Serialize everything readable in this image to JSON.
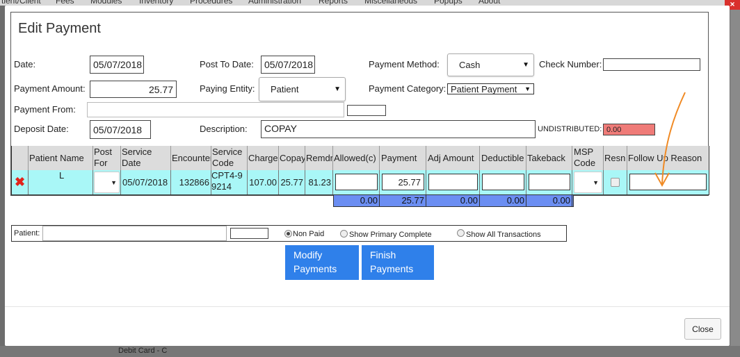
{
  "background": {
    "menu": [
      "tient/Client",
      "Fees",
      "Modules",
      "Inventory",
      "Procedures",
      "Administration",
      "Reports",
      "Miscellaneous",
      "Popups",
      "About"
    ],
    "close_icon": "×",
    "bottom_fragment": "Debit Card - C"
  },
  "modal": {
    "title": "Edit Payment",
    "close_label": "Close"
  },
  "form": {
    "date": {
      "label": "Date:",
      "value": "05/07/2018"
    },
    "post_to_date": {
      "label": "Post To Date:",
      "value": "05/07/2018"
    },
    "payment_method": {
      "label": "Payment Method:",
      "value": "Cash"
    },
    "check_number": {
      "label": "Check Number:",
      "value": ""
    },
    "payment_amount": {
      "label": "Payment Amount:",
      "value": "25.77"
    },
    "paying_entity": {
      "label": "Paying Entity:",
      "value": "Patient"
    },
    "payment_category": {
      "label": "Payment Category:",
      "value": "Patient Payment"
    },
    "payment_from": {
      "label": "Payment From:",
      "value": ""
    },
    "deposit_date": {
      "label": "Deposit Date:",
      "value": "05/07/2018"
    },
    "description": {
      "label": "Description:",
      "value": "COPAY"
    },
    "undistributed": {
      "label": "UNDISTRIBUTED:",
      "value": "0.00",
      "color": "#ef7b78"
    }
  },
  "grid": {
    "headers": {
      "patient_name": "Patient Name",
      "post_for": "Post For",
      "service_date": "Service Date",
      "encounter": "Encounter",
      "service_code": "Service Code",
      "charge": "Charge",
      "copay": "Copay",
      "remdr": "Remdr",
      "allowed": "Allowed(c)",
      "payment": "Payment",
      "adj_amount": "Adj Amount",
      "deductible": "Deductible",
      "takeback": "Takeback",
      "msp_code": "MSP Code",
      "resn": "Resn",
      "follow_up_reason": "Follow Up Reason"
    },
    "row": {
      "delete_icon": "✖",
      "patient_name": "L",
      "service_date": "05/07/2018",
      "encounter": "132866",
      "service_code": "CPT4-99214",
      "charge": "107.00",
      "copay": "25.77",
      "remdr": "81.23",
      "allowed": "",
      "payment": "25.77",
      "adj_amount": "",
      "deductible": "",
      "takeback": "",
      "follow_up_reason": ""
    },
    "totals": {
      "allowed": "0.00",
      "payment": "25.77",
      "adj_amount": "0.00",
      "deductible": "0.00",
      "takeback": "0.00"
    },
    "row_color": "#a9f7f7",
    "totals_color": "#6b8ef2"
  },
  "filter": {
    "patient_label": "Patient:",
    "patient_value": "",
    "options": [
      "Non Paid",
      "Show Primary Complete",
      "Show All Transactions"
    ],
    "selected": "Non Paid"
  },
  "actions": {
    "modify": "Modify Payments",
    "finish": "Finish Payments",
    "accent": "#2f80ea"
  },
  "annotation": {
    "arrow_color": "#f08a24"
  }
}
